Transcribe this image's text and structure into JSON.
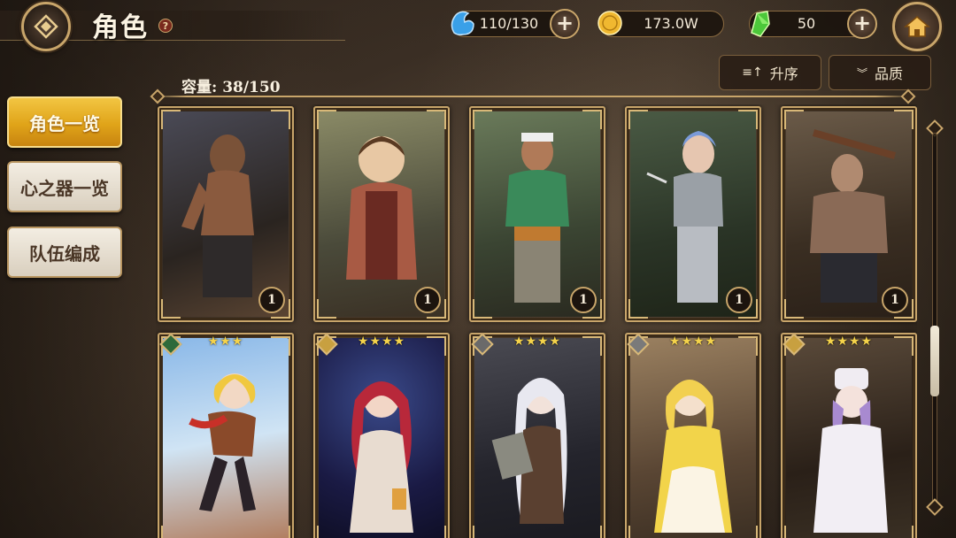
{
  "header": {
    "title": "角色",
    "help": "?"
  },
  "resources": {
    "stamina": "110/130",
    "gold": "173.0W",
    "gems": "50"
  },
  "nav": {
    "items": [
      {
        "label": "角色一览",
        "active": true
      },
      {
        "label": "心之器一览",
        "active": false
      },
      {
        "label": "队伍编成",
        "active": false
      }
    ]
  },
  "toolbar": {
    "sort_label": "升序",
    "filter_label": "品质"
  },
  "capacity": "容量: 38/150",
  "cards": [
    {
      "level": "1",
      "stars": "",
      "colors": [
        "#3a3a44",
        "#6a5a4a"
      ]
    },
    {
      "level": "1",
      "stars": "",
      "colors": [
        "#6a6a50",
        "#3a3a2a"
      ]
    },
    {
      "level": "1",
      "stars": "",
      "colors": [
        "#4a5a40",
        "#2a3424"
      ]
    },
    {
      "level": "1",
      "stars": "",
      "colors": [
        "#3a4a38",
        "#1e2a1c"
      ]
    },
    {
      "level": "1",
      "stars": "",
      "colors": [
        "#5a4a3a",
        "#2a2018"
      ]
    },
    {
      "level": "",
      "stars": "★★★",
      "colors": [
        "#7ab0e0",
        "#c0d8f0"
      ]
    },
    {
      "level": "",
      "stars": "★★★★",
      "colors": [
        "#1a2a5a",
        "#3a1a3a"
      ]
    },
    {
      "level": "",
      "stars": "★★★★",
      "colors": [
        "#3a3a40",
        "#1a1a22"
      ]
    },
    {
      "level": "",
      "stars": "★★★★",
      "colors": [
        "#8a6a3a",
        "#e8c060"
      ]
    },
    {
      "level": "",
      "stars": "★★★★",
      "colors": [
        "#3a3028",
        "#1a1410"
      ]
    }
  ]
}
